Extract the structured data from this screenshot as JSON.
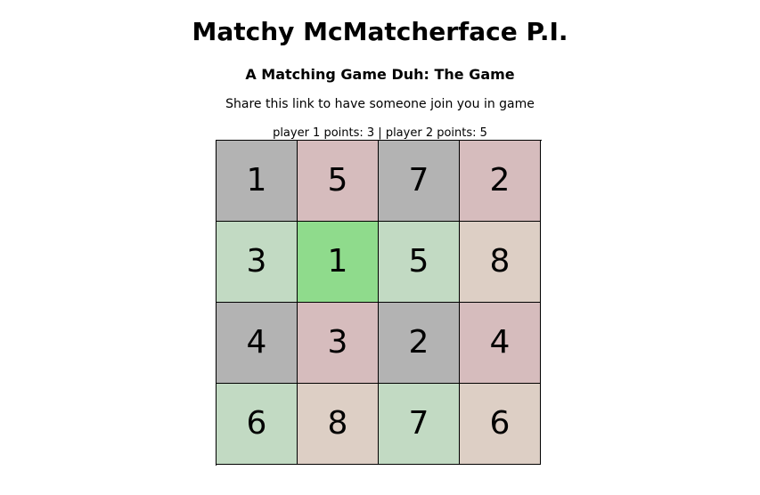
{
  "title": "Matchy McMatcherface P.I.",
  "subtitle": "A Matching Game Duh: The Game",
  "share_text": "Share this link to have someone join you in game",
  "score_text": "player 1 points: 3 | player 2 points: 5",
  "players": [
    {
      "name": "player 1",
      "points": 3
    },
    {
      "name": "player 2",
      "points": 5
    }
  ],
  "colors": {
    "gray": "#b3b3b3",
    "pink": "#d6bcbd",
    "light_green": "#c2dac3",
    "bright_green": "#8fdb8c",
    "beige": "#ddcfc5"
  },
  "board": {
    "tiles": [
      {
        "value": "1",
        "color": "gray"
      },
      {
        "value": "5",
        "color": "pink"
      },
      {
        "value": "7",
        "color": "gray"
      },
      {
        "value": "2",
        "color": "pink"
      },
      {
        "value": "3",
        "color": "light_green"
      },
      {
        "value": "1",
        "color": "bright_green"
      },
      {
        "value": "5",
        "color": "light_green"
      },
      {
        "value": "8",
        "color": "beige"
      },
      {
        "value": "4",
        "color": "gray"
      },
      {
        "value": "3",
        "color": "pink"
      },
      {
        "value": "2",
        "color": "gray"
      },
      {
        "value": "4",
        "color": "pink"
      },
      {
        "value": "6",
        "color": "light_green"
      },
      {
        "value": "8",
        "color": "beige"
      },
      {
        "value": "7",
        "color": "light_green"
      },
      {
        "value": "6",
        "color": "beige"
      }
    ]
  }
}
